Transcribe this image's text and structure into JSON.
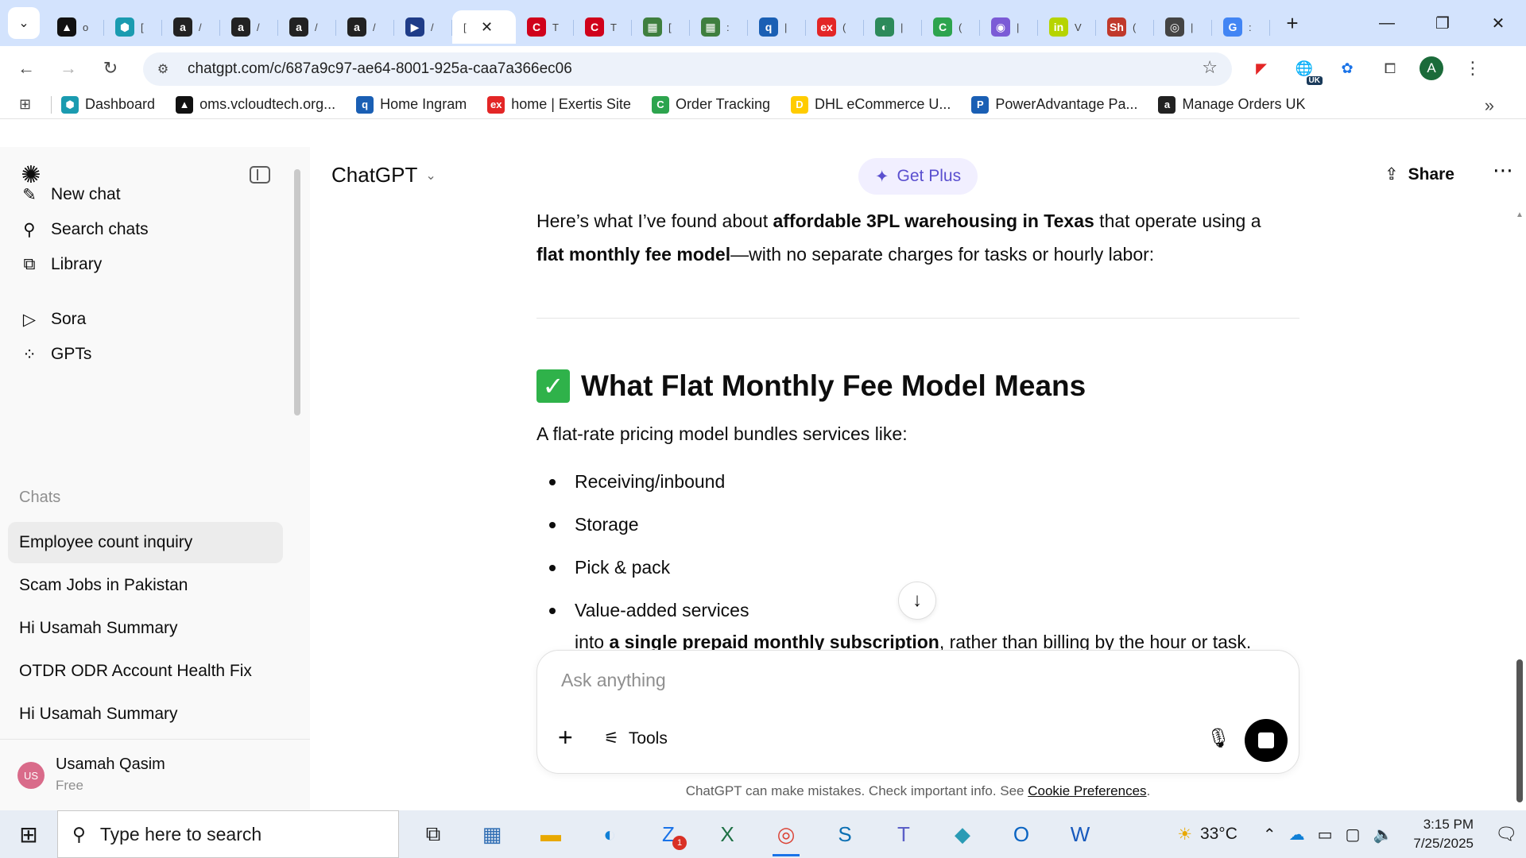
{
  "browser": {
    "tabs": [
      {
        "icon": "▲",
        "color": "#111111",
        "label": "o"
      },
      {
        "icon": "⬢",
        "color": "#1a9bb0",
        "label": "["
      },
      {
        "icon": "a",
        "color": "#222222",
        "label": "/"
      },
      {
        "icon": "a",
        "color": "#222222",
        "label": "/"
      },
      {
        "icon": "a",
        "color": "#222222",
        "label": "/"
      },
      {
        "icon": "a",
        "color": "#222222",
        "label": "/"
      },
      {
        "icon": "▶",
        "color": "#1f3c88",
        "label": "/"
      },
      {
        "icon": "C",
        "color": "#d0021b",
        "label": "T"
      },
      {
        "icon": "C",
        "color": "#d0021b",
        "label": "T"
      },
      {
        "icon": "▦",
        "color": "#3f7f3f",
        "label": "["
      },
      {
        "icon": "▦",
        "color": "#3f7f3f",
        "label": ":"
      },
      {
        "icon": "q",
        "color": "#1a5fb4",
        "label": "|"
      },
      {
        "icon": "ex",
        "color": "#e32626",
        "label": "("
      },
      {
        "icon": "◐",
        "color": "#2d8a5b",
        "label": "|"
      },
      {
        "icon": "C",
        "color": "#2da44e",
        "label": "("
      },
      {
        "icon": "◉",
        "color": "#7b5bd6",
        "label": "|"
      },
      {
        "icon": "in",
        "color": "#b6d400",
        "label": "V"
      },
      {
        "icon": "Sh",
        "color": "#c0392b",
        "label": "("
      },
      {
        "icon": "◎",
        "color": "#444444",
        "label": "|"
      },
      {
        "icon": "G",
        "color": "#4285f4",
        "label": ":"
      }
    ],
    "active_tab_label": "[",
    "url": "chatgpt.com/c/687a9c97-ae64-8001-925a-caa7a366ec06",
    "bookmarks": [
      {
        "label": "Dashboard",
        "icon": "⬢",
        "color": "#1a9bb0"
      },
      {
        "label": "oms.vcloudtech.org...",
        "icon": "▲",
        "color": "#111111"
      },
      {
        "label": "Home Ingram",
        "icon": "q",
        "color": "#1a5fb4"
      },
      {
        "label": "home | Exertis Site",
        "icon": "ex",
        "color": "#e32626"
      },
      {
        "label": "Order Tracking",
        "icon": "C",
        "color": "#2da44e"
      },
      {
        "label": "DHL eCommerce U...",
        "icon": "D",
        "color": "#ffcc00"
      },
      {
        "label": "PowerAdvantage Pa...",
        "icon": "P",
        "color": "#1a5fb4"
      },
      {
        "label": "Manage Orders UK",
        "icon": "a",
        "color": "#222222"
      }
    ],
    "profile_initial": "A",
    "extension_badge": "UK"
  },
  "sidebar": {
    "nav": [
      {
        "label": "New chat",
        "icon": "✎",
        "name": "new-chat"
      },
      {
        "label": "Search chats",
        "icon": "⚲",
        "name": "search-chats"
      },
      {
        "label": "Library",
        "icon": "⧉",
        "name": "library"
      },
      {
        "label": "Sora",
        "icon": "▷",
        "name": "sora"
      },
      {
        "label": "GPTs",
        "icon": "⁘",
        "name": "gpts"
      }
    ],
    "chats_heading": "Chats",
    "chats": [
      "Employee count inquiry",
      "Scam Jobs in Pakistan",
      "Hi Usamah Summary",
      "OTDR ODR Account Health Fix",
      "Hi Usamah Summary"
    ],
    "user": {
      "initials": "US",
      "name": "Usamah Qasim",
      "plan": "Free"
    }
  },
  "header": {
    "model": "ChatGPT",
    "get_plus": "Get Plus",
    "share": "Share"
  },
  "message": {
    "intro_1": "Here’s what I’ve found about ",
    "intro_bold_1": "affordable 3PL warehousing in Texas",
    "intro_2": " that operate using a",
    "intro_bold_2": "flat monthly fee model",
    "intro_3": "—with no separate charges for tasks or hourly labor:",
    "heading_emoji": "✓",
    "heading": "What Flat Monthly Fee Model Means",
    "lead": "A flat-rate pricing model bundles services like:",
    "bullets": [
      "Receiving/inbound",
      "Storage",
      "Pick & pack",
      "Value-added services"
    ],
    "tail_1": "into ",
    "tail_bold": "a single prepaid monthly subscription",
    "tail_2": ", rather than billing by the hour or task."
  },
  "composer": {
    "placeholder": "Ask anything",
    "tools": "Tools"
  },
  "disclaimer": {
    "text": "ChatGPT can make mistakes. Check important info. See ",
    "link": "Cookie Preferences",
    "end": "."
  },
  "taskbar": {
    "search_placeholder": "Type here to search",
    "apps": [
      {
        "icon": "⧉",
        "name": "task-view",
        "color": "#1a1a1a"
      },
      {
        "icon": "▦",
        "name": "calculator",
        "color": "#2f6db3"
      },
      {
        "icon": "▬",
        "name": "file-explorer",
        "color": "#e8a800"
      },
      {
        "icon": "◐",
        "name": "edge",
        "color": "#0f7fd6"
      },
      {
        "icon": "Z",
        "name": "zoho",
        "color": "#1a73e8",
        "badge": "1"
      },
      {
        "icon": "X",
        "name": "excel",
        "color": "#1d7044"
      },
      {
        "icon": "◎",
        "name": "chrome",
        "color": "#db4437",
        "running": true
      },
      {
        "icon": "S",
        "name": "sourcetree",
        "color": "#0b6fb3"
      },
      {
        "icon": "T",
        "name": "teams",
        "color": "#5b5fc7"
      },
      {
        "icon": "◆",
        "name": "app-diamond",
        "color": "#2a9bb5"
      },
      {
        "icon": "O",
        "name": "outlook",
        "color": "#0a64c2"
      },
      {
        "icon": "W",
        "name": "word",
        "color": "#185abd"
      }
    ],
    "temperature": "33°C",
    "time": "3:15 PM",
    "date": "7/25/2025"
  }
}
